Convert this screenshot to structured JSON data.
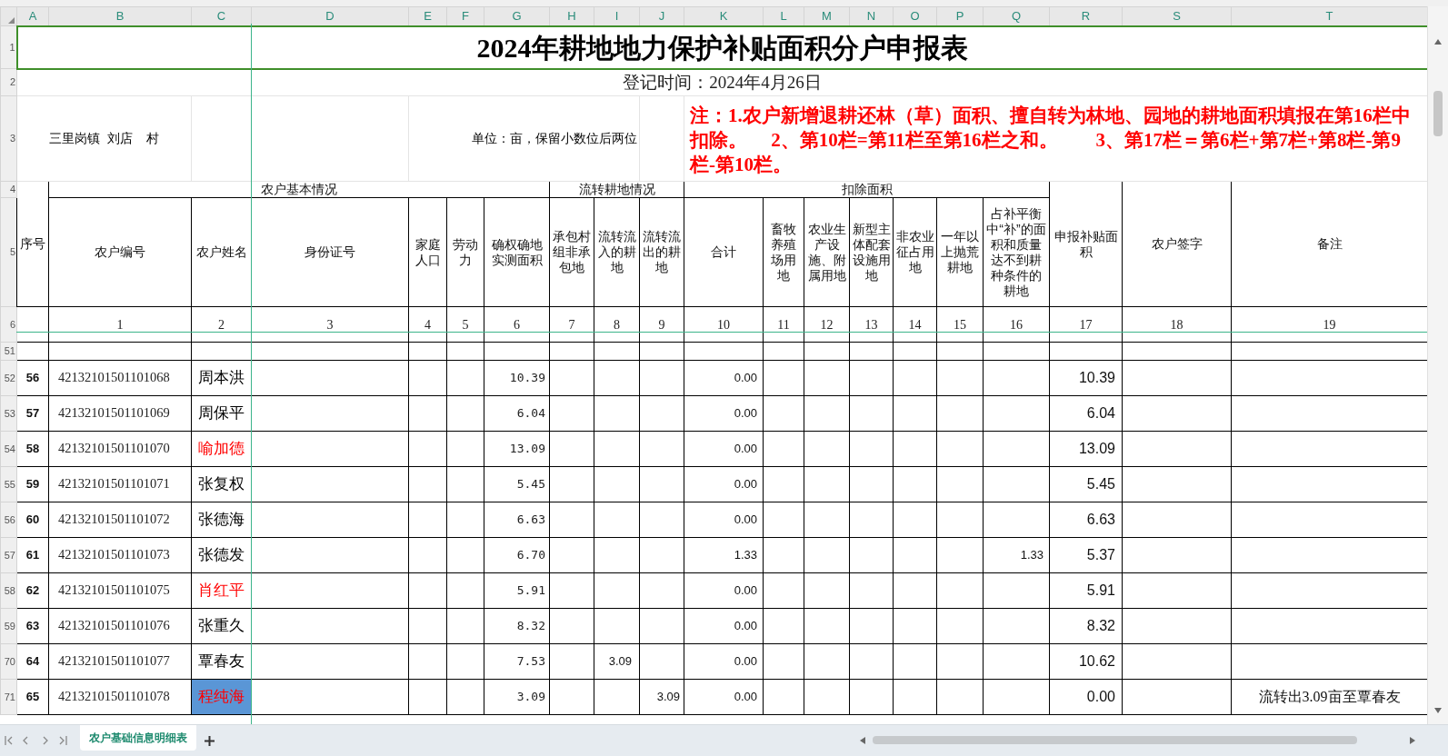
{
  "column_letters": [
    "A",
    "B",
    "C",
    "D",
    "E",
    "F",
    "G",
    "H",
    "I",
    "J",
    "K",
    "L",
    "M",
    "N",
    "O",
    "P",
    "Q",
    "R",
    "S",
    "T"
  ],
  "title": "2024年耕地地力保护补贴面积分户申报表",
  "date": "登记时间：2024年4月26日",
  "location": "三里岗镇  刘店    村",
  "unit": "单位：亩，保留小数位后两位",
  "note": "注：1.农户新增退耕还林（草）面积、擅自转为林地、园地的耕地面积填报在第16栏中扣除。     2、第10栏=第11栏至第16栏之和。        3、第17栏＝第6栏+第7栏+第8栏-第9栏-第10栏。",
  "seq_header": "序号",
  "groups": [
    "农户基本情况",
    "流转耕地情况",
    "扣除面积"
  ],
  "columns": [
    {
      "label": "农户编号",
      "number": "1"
    },
    {
      "label": "农户姓名",
      "number": "2"
    },
    {
      "label": "身份证号",
      "number": "3"
    },
    {
      "label": "家庭人口",
      "number": "4"
    },
    {
      "label": "劳动力",
      "number": "5"
    },
    {
      "label": "确权确地实测面积",
      "number": "6"
    },
    {
      "label": "承包村组非承包地",
      "number": "7"
    },
    {
      "label": "流转流入的耕地",
      "number": "8"
    },
    {
      "label": "流转流出的耕地",
      "number": "9"
    },
    {
      "label": "合计",
      "number": "10"
    },
    {
      "label": "畜牧养殖场用地",
      "number": "11"
    },
    {
      "label": "农业生产设施、附属用地",
      "number": "12"
    },
    {
      "label": "新型主体配套设施用地",
      "number": "13"
    },
    {
      "label": "非农业征占用地",
      "number": "14"
    },
    {
      "label": "一年以上抛荒耕地",
      "number": "15"
    },
    {
      "label": "占补平衡中“补”的面积和质量达不到耕种条件的耕地",
      "number": "16"
    },
    {
      "label": "申报补贴面积",
      "number": "17"
    },
    {
      "label": "农户签字",
      "number": "18"
    },
    {
      "label": "备注",
      "number": "19"
    }
  ],
  "header_row_labels": [
    "1",
    "2",
    "3",
    "4",
    "5",
    "6",
    "51"
  ],
  "rows": [
    {
      "row_label": "52",
      "seq": "56",
      "code": "42132101501101068",
      "name": "周本洪",
      "color": "#000000",
      "selected": false,
      "area": "10.39",
      "total": "0.00",
      "subsidy": "10.39"
    },
    {
      "row_label": "53",
      "seq": "57",
      "code": "42132101501101069",
      "name": "周保平",
      "color": "#000000",
      "selected": false,
      "area": "6.04",
      "total": "0.00",
      "subsidy": "6.04"
    },
    {
      "row_label": "54",
      "seq": "58",
      "code": "42132101501101070",
      "name": "喻加德",
      "color": "#ff0000",
      "selected": false,
      "area": "13.09",
      "total": "0.00",
      "subsidy": "13.09"
    },
    {
      "row_label": "55",
      "seq": "59",
      "code": "42132101501101071",
      "name": "张复权",
      "color": "#000000",
      "selected": false,
      "area": "5.45",
      "total": "0.00",
      "subsidy": "5.45"
    },
    {
      "row_label": "56",
      "seq": "60",
      "code": "42132101501101072",
      "name": "张德海",
      "color": "#000000",
      "selected": false,
      "area": "6.63",
      "total": "0.00",
      "subsidy": "6.63"
    },
    {
      "row_label": "57",
      "seq": "61",
      "code": "42132101501101073",
      "name": "张德发",
      "color": "#000000",
      "selected": false,
      "area": "6.70",
      "total": "1.33",
      "col16": "1.33",
      "subsidy": "5.37"
    },
    {
      "row_label": "58",
      "seq": "62",
      "code": "42132101501101075",
      "name": "肖红平",
      "color": "#ff0000",
      "selected": false,
      "area": "5.91",
      "total": "0.00",
      "subsidy": "5.91"
    },
    {
      "row_label": "59",
      "seq": "63",
      "code": "42132101501101076",
      "name": "张重久",
      "color": "#000000",
      "selected": false,
      "area": "8.32",
      "total": "0.00",
      "subsidy": "8.32"
    },
    {
      "row_label": "70",
      "seq": "64",
      "code": "42132101501101077",
      "name": "覃春友",
      "color": "#000000",
      "selected": false,
      "area": "7.53",
      "transfer_in": "3.09",
      "total": "0.00",
      "subsidy": "10.62"
    },
    {
      "row_label": "71",
      "seq": "65",
      "code": "42132101501101078",
      "name": "程纯海",
      "color": "#ff0000",
      "selected": true,
      "area": "3.09",
      "transfer_out": "3.09",
      "total": "0.00",
      "subsidy": "0.00",
      "note": "流转出3.09亩至覃春友"
    }
  ],
  "sheet_tabs": [
    {
      "label": "农户基础信息明细表",
      "selected": true
    }
  ]
}
